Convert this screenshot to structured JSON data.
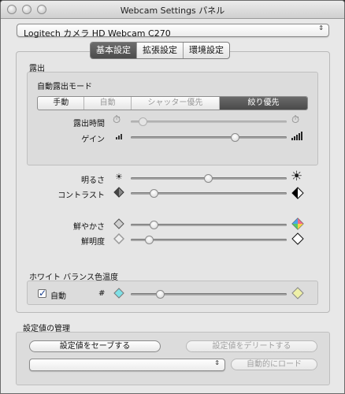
{
  "window": {
    "title": "Webcam Settings パネル"
  },
  "camera_select": {
    "value": "Logitech カメラ HD Webcam C270",
    "arrow": "⇕"
  },
  "tabs": [
    {
      "label": "基本設定",
      "active": true
    },
    {
      "label": "拡張設定",
      "active": false
    },
    {
      "label": "環境設定",
      "active": false
    }
  ],
  "exposure": {
    "heading": "露出",
    "auto_mode_label": "自動露出モード",
    "modes": [
      {
        "label": "手動",
        "state": "normal"
      },
      {
        "label": "自動",
        "state": "disabled"
      },
      {
        "label": "シャッター優先",
        "state": "disabled"
      },
      {
        "label": "絞り優先",
        "state": "selected"
      }
    ],
    "time": {
      "label": "露出時間",
      "value": 0.08,
      "enabled": false
    },
    "gain": {
      "label": "ゲイン",
      "value": 0.67,
      "enabled": true
    }
  },
  "image": {
    "brightness": {
      "label": "明るさ",
      "value": 0.5
    },
    "contrast": {
      "label": "コントラスト",
      "value": 0.15
    },
    "saturation": {
      "label": "鮮やかさ",
      "value": 0.15
    },
    "sharpness": {
      "label": "鮮明度",
      "value": 0.12
    }
  },
  "white_balance": {
    "heading": "ホワイト バランス色温度",
    "auto_label": "自動",
    "auto_checked": true,
    "hash_label": "#",
    "value": 0.19
  },
  "settings_mgmt": {
    "heading": "設定値の管理",
    "save_label": "設定値をセーブする",
    "delete_label": "設定値をデリートする",
    "autoload_label": "自動的にロード",
    "preset_value": ""
  }
}
